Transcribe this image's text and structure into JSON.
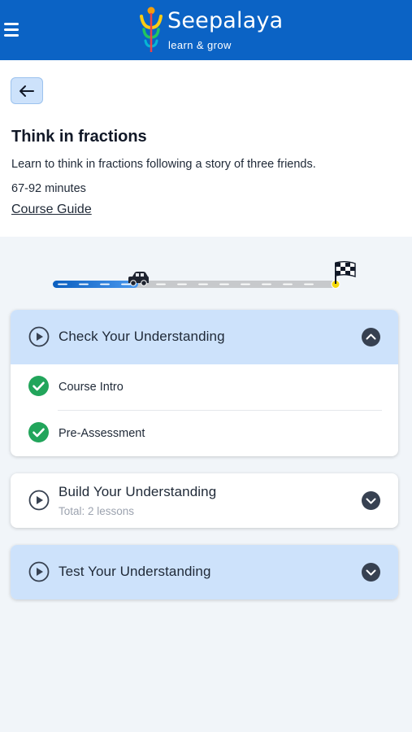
{
  "app": {
    "brand": "Seepalaya",
    "tagline": "learn & grow"
  },
  "course": {
    "title": "Think in fractions",
    "description": "Learn to think in fractions following a story of three friends.",
    "duration": "67-92 minutes",
    "guide_link": "Course Guide"
  },
  "progress": {
    "fraction": 0.3
  },
  "sections": [
    {
      "title": "Check Your Understanding",
      "expanded": true,
      "lessons": [
        {
          "label": "Course Intro",
          "completed": true
        },
        {
          "label": "Pre-Assessment",
          "completed": true
        }
      ]
    },
    {
      "title": "Build Your Understanding",
      "subtitle": "Total: 2 lessons",
      "expanded": false
    },
    {
      "title": "Test Your Understanding",
      "expanded": false
    }
  ],
  "colors": {
    "primary": "#0b63c5",
    "section_highlight": "#cde2fb",
    "check_green": "#22a55b",
    "flag_dot": "#f5d90a"
  },
  "icons": {
    "menu": "hamburger-icon",
    "back": "arrow-left-icon",
    "play": "play-circle-icon",
    "expand": "chevron-down-icon",
    "collapse": "chevron-up-icon",
    "done": "check-circle-icon",
    "vehicle": "car-icon",
    "finish": "checkered-flag-icon"
  }
}
